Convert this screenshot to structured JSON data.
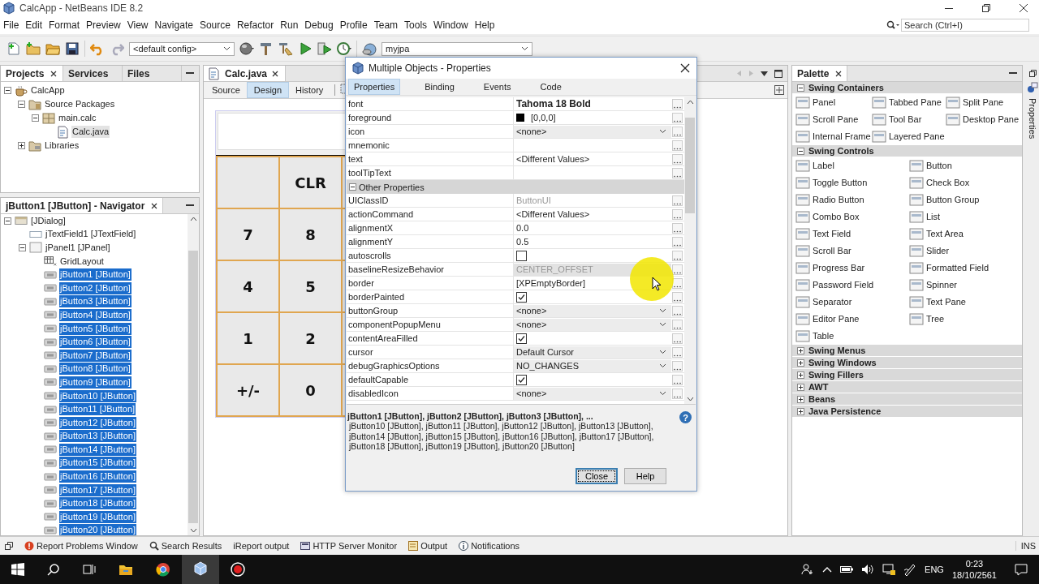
{
  "window": {
    "title": "CalcApp - NetBeans IDE 8.2"
  },
  "menu": [
    "File",
    "Edit",
    "Format",
    "Preview",
    "View",
    "Navigate",
    "Source",
    "Refactor",
    "Run",
    "Debug",
    "Profile",
    "Team",
    "Tools",
    "Window",
    "Help"
  ],
  "search": {
    "placeholder": "Search (Ctrl+I)"
  },
  "toolbar": {
    "config": "<default config>",
    "project": "myjpa"
  },
  "projects_panel": {
    "tabs": [
      {
        "label": "Projects",
        "selected": true
      },
      {
        "label": "Services",
        "selected": false
      },
      {
        "label": "Files",
        "selected": false
      }
    ],
    "tree": [
      {
        "label": "CalcApp",
        "kind": "project",
        "expanded": true,
        "selected": false,
        "children": [
          {
            "label": "Source Packages",
            "kind": "source",
            "expanded": true,
            "selected": false,
            "children": [
              {
                "label": "main.calc",
                "kind": "package",
                "expanded": true,
                "selected": false,
                "children": [
                  {
                    "label": "Calc.java",
                    "kind": "java",
                    "selected": true
                  }
                ]
              }
            ]
          },
          {
            "label": "Libraries",
            "kind": "library",
            "expanded": false,
            "selected": false
          }
        ]
      }
    ]
  },
  "navigator": {
    "title": "jButton1 [JButton] - Navigator",
    "tree": [
      {
        "label": "[JDialog]",
        "kind": "dialog",
        "expanded": true,
        "selected": false,
        "children": [
          {
            "label": "jTextField1 [JTextField]",
            "kind": "textfield",
            "selected": false
          },
          {
            "label": "jPanel1 [JPanel]",
            "kind": "panel",
            "expanded": true,
            "selected": false,
            "children": [
              {
                "label": "GridLayout",
                "kind": "layout",
                "selected": false
              },
              {
                "label": "jButton1 [JButton]",
                "kind": "button",
                "selected": true
              },
              {
                "label": "jButton2 [JButton]",
                "kind": "button",
                "selected": true
              },
              {
                "label": "jButton3 [JButton]",
                "kind": "button",
                "selected": true
              },
              {
                "label": "jButton4 [JButton]",
                "kind": "button",
                "selected": true
              },
              {
                "label": "jButton5 [JButton]",
                "kind": "button",
                "selected": true
              },
              {
                "label": "jButton6 [JButton]",
                "kind": "button",
                "selected": true
              },
              {
                "label": "jButton7 [JButton]",
                "kind": "button",
                "selected": true
              },
              {
                "label": "jButton8 [JButton]",
                "kind": "button",
                "selected": true
              },
              {
                "label": "jButton9 [JButton]",
                "kind": "button",
                "selected": true
              },
              {
                "label": "jButton10 [JButton]",
                "kind": "button",
                "selected": true
              },
              {
                "label": "jButton11 [JButton]",
                "kind": "button",
                "selected": true
              },
              {
                "label": "jButton12 [JButton]",
                "kind": "button",
                "selected": true
              },
              {
                "label": "jButton13 [JButton]",
                "kind": "button",
                "selected": true
              },
              {
                "label": "jButton14 [JButton]",
                "kind": "button",
                "selected": true
              },
              {
                "label": "jButton15 [JButton]",
                "kind": "button",
                "selected": true
              },
              {
                "label": "jButton16 [JButton]",
                "kind": "button",
                "selected": true
              },
              {
                "label": "jButton17 [JButton]",
                "kind": "button",
                "selected": true
              },
              {
                "label": "jButton18 [JButton]",
                "kind": "button",
                "selected": true
              },
              {
                "label": "jButton19 [JButton]",
                "kind": "button",
                "selected": true
              },
              {
                "label": "jButton20 [JButton]",
                "kind": "button",
                "selected": true
              }
            ]
          }
        ]
      }
    ]
  },
  "editor": {
    "tab": "Calc.java",
    "views": [
      {
        "label": "Source",
        "selected": false
      },
      {
        "label": "Design",
        "selected": true
      },
      {
        "label": "History",
        "selected": false
      }
    ],
    "form": {
      "buttons": [
        {
          "kind": "blank"
        },
        {
          "kind": "key",
          "label": "CLR"
        },
        {
          "kind": "key",
          "label": "7"
        },
        {
          "kind": "key",
          "label": "8"
        },
        {
          "kind": "key",
          "label": "4"
        },
        {
          "kind": "key",
          "label": "5"
        },
        {
          "kind": "key",
          "label": "1"
        },
        {
          "kind": "key",
          "label": "2"
        },
        {
          "kind": "key",
          "label": "+/-"
        },
        {
          "kind": "key",
          "label": "0"
        }
      ]
    }
  },
  "palette": {
    "title": "Palette",
    "categories": [
      {
        "label": "Swing Containers",
        "expanded": true,
        "items": [
          "Panel",
          "Tabbed Pane",
          "Split Pane",
          "Scroll Pane",
          "Tool Bar",
          "Desktop Pane",
          "Internal Frame",
          "Layered Pane"
        ]
      },
      {
        "label": "Swing Controls",
        "expanded": true,
        "items": [
          "Label",
          "Button",
          "Toggle Button",
          "Check Box",
          "Radio Button",
          "Button Group",
          "Combo Box",
          "List",
          "Text Field",
          "Text Area",
          "Scroll Bar",
          "Slider",
          "Progress Bar",
          "Formatted Field",
          "Password Field",
          "Spinner",
          "Separator",
          "Text Pane",
          "Editor Pane",
          "Tree",
          "Table"
        ]
      },
      {
        "label": "Swing Menus",
        "expanded": false
      },
      {
        "label": "Swing Windows",
        "expanded": false
      },
      {
        "label": "Swing Fillers",
        "expanded": false
      },
      {
        "label": "AWT",
        "expanded": false
      },
      {
        "label": "Beans",
        "expanded": false
      },
      {
        "label": "Java Persistence",
        "expanded": false
      }
    ]
  },
  "side_strip": {
    "label": "Properties"
  },
  "dialog": {
    "title": "Multiple Objects - Properties",
    "tabs": [
      {
        "label": "Properties",
        "selected": true
      },
      {
        "label": "Binding",
        "selected": false
      },
      {
        "label": "Events",
        "selected": false
      },
      {
        "label": "Code",
        "selected": false
      }
    ],
    "properties": [
      {
        "name": "font",
        "kind": "font",
        "value": "Tahoma 18 Bold"
      },
      {
        "name": "foreground",
        "kind": "color",
        "color": "#000000",
        "value": "[0,0,0]"
      },
      {
        "name": "icon",
        "kind": "combo",
        "value": "<none>",
        "disabled": false
      },
      {
        "name": "mnemonic",
        "kind": "text"
      },
      {
        "name": "text",
        "kind": "text",
        "value": "<Different Values>",
        "disabled": false
      },
      {
        "name": "toolTipText",
        "kind": "text"
      },
      {
        "kind": "category",
        "name": "Other Properties",
        "expanded": true
      },
      {
        "name": "UIClassID",
        "kind": "text",
        "value": "ButtonUI",
        "disabled": true
      },
      {
        "name": "actionCommand",
        "kind": "text",
        "value": "<Different Values>",
        "disabled": false
      },
      {
        "name": "alignmentX",
        "kind": "text",
        "value": "0.0",
        "disabled": false
      },
      {
        "name": "alignmentY",
        "kind": "text",
        "value": "0.5",
        "disabled": false
      },
      {
        "name": "autoscrolls",
        "kind": "checkbox",
        "checked": false
      },
      {
        "name": "baselineResizeBehavior",
        "kind": "combo",
        "value": "CENTER_OFFSET",
        "disabled": true
      },
      {
        "name": "border",
        "kind": "text",
        "value": "[XPEmptyBorder]",
        "disabled": false
      },
      {
        "name": "borderPainted",
        "kind": "checkbox",
        "checked": true
      },
      {
        "name": "buttonGroup",
        "kind": "combo",
        "value": "<none>",
        "disabled": false
      },
      {
        "name": "componentPopupMenu",
        "kind": "combo",
        "value": "<none>",
        "disabled": false
      },
      {
        "name": "contentAreaFilled",
        "kind": "checkbox",
        "checked": true
      },
      {
        "name": "cursor",
        "kind": "combo",
        "value": "Default Cursor",
        "disabled": false
      },
      {
        "name": "debugGraphicsOptions",
        "kind": "combo",
        "value": "NO_CHANGES",
        "disabled": false
      },
      {
        "name": "defaultCapable",
        "kind": "checkbox",
        "checked": true
      },
      {
        "name": "disabledIcon",
        "kind": "combo",
        "value": "<none>",
        "disabled": false
      }
    ],
    "description": {
      "title": "jButton1 [JButton], jButton2 [JButton], jButton3 [JButton], ...",
      "lines": [
        "jButton10 [JButton], jButton11 [JButton], jButton12 [JButton], jButton13 [JButton],",
        "jButton14 [JButton], jButton15 [JButton], jButton16 [JButton], jButton17 [JButton],",
        "jButton18 [JButton], jButton19 [JButton], jButton20 [JButton]"
      ]
    },
    "help_glyph": "?",
    "buttons": [
      {
        "label": "Close",
        "focused": true
      },
      {
        "label": "Help",
        "focused": false
      }
    ]
  },
  "status_bar": {
    "tabs": [
      {
        "label": "Report Problems Window",
        "kind": "problems"
      },
      {
        "label": "Search Results",
        "kind": "search"
      },
      {
        "label": "iReport output",
        "kind": "plain"
      },
      {
        "label": "HTTP Server Monitor",
        "kind": "monitor"
      },
      {
        "label": "Output",
        "kind": "output"
      },
      {
        "label": "Notifications",
        "kind": "info"
      }
    ],
    "mode": "INS"
  },
  "taskbar": {
    "language": "ENG",
    "time": "0:23",
    "date": "18/10/2561"
  }
}
